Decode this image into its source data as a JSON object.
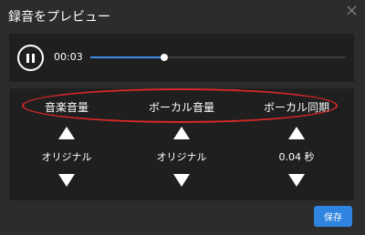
{
  "dialog": {
    "title": "録音をプレビュー",
    "close_icon": "close-icon"
  },
  "player": {
    "state": "playing",
    "pause_icon": "pause-icon",
    "current_time": "00:03",
    "progress": 0.29,
    "colors": {
      "progress": "#3d8ee6",
      "track": "#3d3d3d"
    }
  },
  "controls": {
    "columns": [
      {
        "label": "音楽音量",
        "value": "オリジナル"
      },
      {
        "label": "ボーカル音量",
        "value": "オリジナル"
      },
      {
        "label": "ボーカル同期",
        "value": "0.04 秒"
      }
    ]
  },
  "annotation": {
    "color": "#d62828"
  },
  "footer": {
    "save_label": "保存",
    "accent": "#2f84df"
  }
}
